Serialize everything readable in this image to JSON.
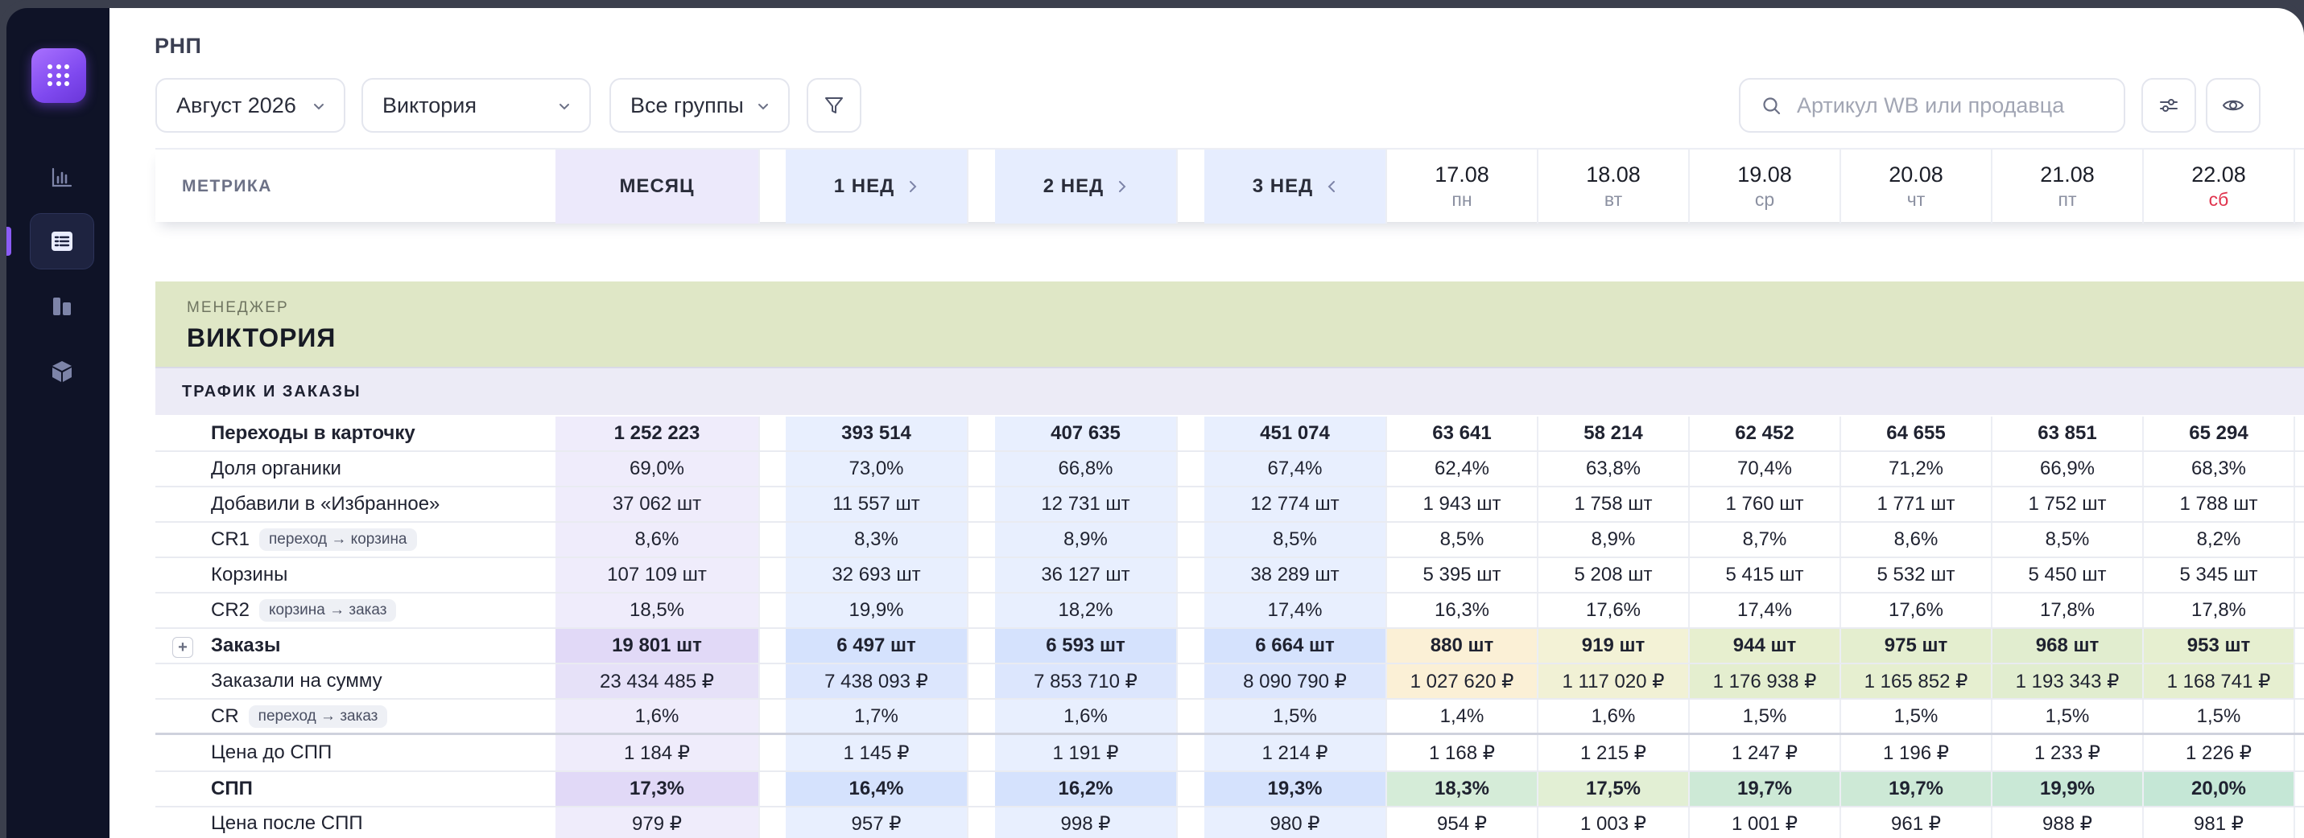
{
  "page": {
    "title": "РНП"
  },
  "filters": {
    "period": "Август 2026",
    "manager": "Виктория",
    "group": "Все группы"
  },
  "search": {
    "placeholder": "Артикул WB или продавца",
    "value": ""
  },
  "table_head": {
    "metric": "МЕТРИКА",
    "month": "МЕСЯЦ",
    "weeks": [
      "1  НЕД",
      "2  НЕД",
      "3  НЕД"
    ],
    "days": [
      {
        "date": "17.08",
        "dow": "пн"
      },
      {
        "date": "18.08",
        "dow": "вт"
      },
      {
        "date": "19.08",
        "dow": "ср"
      },
      {
        "date": "20.08",
        "dow": "чт"
      },
      {
        "date": "21.08",
        "dow": "пт"
      },
      {
        "date": "22.08",
        "dow": "сб"
      }
    ]
  },
  "manager_block": {
    "caption": "МЕНЕДЖЕР",
    "name": "ВИКТОРИЯ"
  },
  "section": {
    "title": "ТРАФИК И ЗАКАЗЫ"
  },
  "rows": [
    {
      "label": "Переходы в карточку",
      "tag": "",
      "month": "1 252 223",
      "w1": "393 514",
      "w2": "407 635",
      "w3": "451 074",
      "days": [
        "63 641",
        "58 214",
        "62 452",
        "64 655",
        "63 851",
        "65 294"
      ]
    },
    {
      "label": "Доля органики",
      "tag": "",
      "month": "69,0%",
      "w1": "73,0%",
      "w2": "66,8%",
      "w3": "67,4%",
      "days": [
        "62,4%",
        "63,8%",
        "70,4%",
        "71,2%",
        "66,9%",
        "68,3%"
      ]
    },
    {
      "label": "Добавили в «Избранное»",
      "tag": "",
      "month": "37 062 шт",
      "w1": "11 557 шт",
      "w2": "12 731 шт",
      "w3": "12 774 шт",
      "days": [
        "1 943 шт",
        "1 758 шт",
        "1 760 шт",
        "1 771 шт",
        "1 752 шт",
        "1 788 шт"
      ]
    },
    {
      "label": "CR1",
      "tag": "переход → корзина",
      "month": "8,6%",
      "w1": "8,3%",
      "w2": "8,9%",
      "w3": "8,5%",
      "days": [
        "8,5%",
        "8,9%",
        "8,7%",
        "8,6%",
        "8,5%",
        "8,2%"
      ]
    },
    {
      "label": "Корзины",
      "tag": "",
      "month": "107 109 шт",
      "w1": "32 693 шт",
      "w2": "36 127 шт",
      "w3": "38 289 шт",
      "days": [
        "5 395 шт",
        "5 208 шт",
        "5 415 шт",
        "5 532 шт",
        "5 450 шт",
        "5 345 шт"
      ]
    },
    {
      "label": "CR2",
      "tag": "корзина → заказ",
      "month": "18,5%",
      "w1": "19,9%",
      "w2": "18,2%",
      "w3": "17,4%",
      "days": [
        "16,3%",
        "17,6%",
        "17,4%",
        "17,6%",
        "17,8%",
        "17,8%"
      ]
    },
    {
      "label": "Заказы",
      "tag": "",
      "month": "19 801 шт",
      "w1": "6 497 шт",
      "w2": "6 593 шт",
      "w3": "6 664 шт",
      "days": [
        "880 шт",
        "919 шт",
        "944 шт",
        "975 шт",
        "968 шт",
        "953 шт"
      ]
    },
    {
      "label": "Заказали на сумму",
      "tag": "",
      "month": "23 434 485 ₽",
      "w1": "7 438 093 ₽",
      "w2": "7 853 710 ₽",
      "w3": "8 090 790 ₽",
      "days": [
        "1 027 620 ₽",
        "1 117 020 ₽",
        "1 176 938 ₽",
        "1 165 852 ₽",
        "1 193 343 ₽",
        "1 168 741 ₽"
      ]
    },
    {
      "label": "CR",
      "tag": "переход → заказ",
      "month": "1,6%",
      "w1": "1,7%",
      "w2": "1,6%",
      "w3": "1,5%",
      "days": [
        "1,4%",
        "1,6%",
        "1,5%",
        "1,5%",
        "1,5%",
        "1,5%"
      ]
    },
    {
      "label": "Цена до СПП",
      "tag": "",
      "month": "1 184 ₽",
      "w1": "1 145 ₽",
      "w2": "1 191 ₽",
      "w3": "1 214 ₽",
      "days": [
        "1 168 ₽",
        "1 215 ₽",
        "1 247 ₽",
        "1 196 ₽",
        "1 233 ₽",
        "1 226 ₽"
      ]
    },
    {
      "label": "СПП",
      "tag": "",
      "month": "17,3%",
      "w1": "16,4%",
      "w2": "16,2%",
      "w3": "19,3%",
      "days": [
        "18,3%",
        "17,5%",
        "19,7%",
        "19,7%",
        "19,9%",
        "20,0%"
      ]
    },
    {
      "label": "Цена после СПП",
      "tag": "",
      "month": "979 ₽",
      "w1": "957 ₽",
      "w2": "998 ₽",
      "w3": "980 ₽",
      "days": [
        "954 ₽",
        "1 003 ₽",
        "1 001 ₽",
        "961 ₽",
        "988 ₽",
        "981 ₽"
      ]
    }
  ],
  "colors": {
    "accent": "#8b5cf6",
    "month_col": "#efecfb",
    "week_col": "#e8effe",
    "manager_bg": "#dfe7c6",
    "heat_low": "#fbf0d6",
    "heat_mid": "#e7efcf",
    "heat_high": "#cde9d6",
    "weekend": "#e0334d"
  },
  "icons": {
    "sidebar": [
      "analytics-chart-icon",
      "table-list-icon",
      "columns-icon",
      "cube-icon"
    ],
    "toolbar": [
      "filter-icon",
      "search-icon",
      "sliders-icon",
      "eye-icon"
    ]
  }
}
